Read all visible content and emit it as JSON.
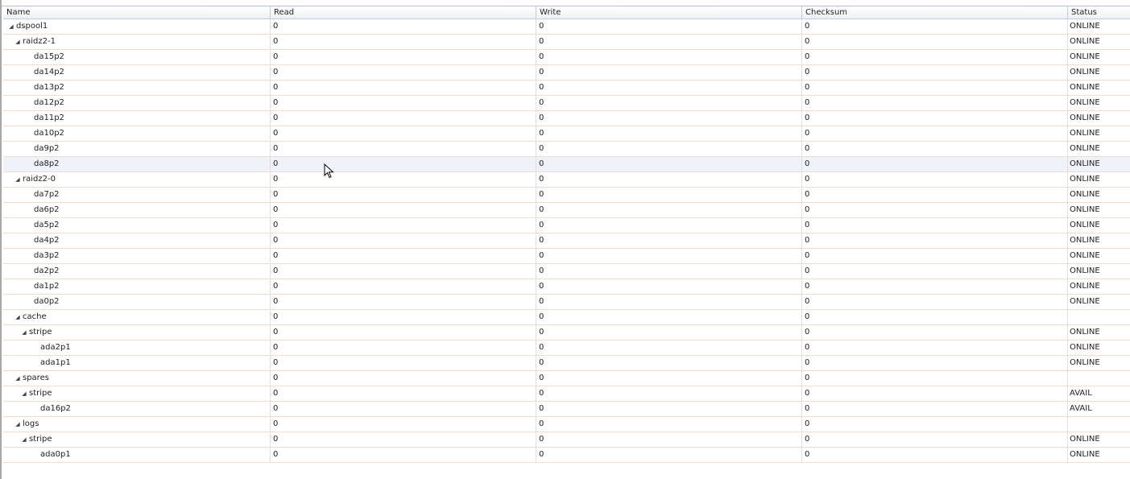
{
  "columns": {
    "name": "Name",
    "read": "Read",
    "write": "Write",
    "checksum": "Checksum",
    "status": "Status"
  },
  "rows": [
    {
      "name": "dspool1",
      "level": 0,
      "expandable": true,
      "read": "0",
      "write": "0",
      "checksum": "0",
      "status": "ONLINE"
    },
    {
      "name": "raidz2-1",
      "level": 1,
      "expandable": true,
      "read": "0",
      "write": "0",
      "checksum": "0",
      "status": "ONLINE"
    },
    {
      "name": "da15p2",
      "level": 2,
      "expandable": false,
      "read": "0",
      "write": "0",
      "checksum": "0",
      "status": "ONLINE"
    },
    {
      "name": "da14p2",
      "level": 2,
      "expandable": false,
      "read": "0",
      "write": "0",
      "checksum": "0",
      "status": "ONLINE"
    },
    {
      "name": "da13p2",
      "level": 2,
      "expandable": false,
      "read": "0",
      "write": "0",
      "checksum": "0",
      "status": "ONLINE"
    },
    {
      "name": "da12p2",
      "level": 2,
      "expandable": false,
      "read": "0",
      "write": "0",
      "checksum": "0",
      "status": "ONLINE"
    },
    {
      "name": "da11p2",
      "level": 2,
      "expandable": false,
      "read": "0",
      "write": "0",
      "checksum": "0",
      "status": "ONLINE"
    },
    {
      "name": "da10p2",
      "level": 2,
      "expandable": false,
      "read": "0",
      "write": "0",
      "checksum": "0",
      "status": "ONLINE"
    },
    {
      "name": "da9p2",
      "level": 2,
      "expandable": false,
      "read": "0",
      "write": "0",
      "checksum": "0",
      "status": "ONLINE"
    },
    {
      "name": "da8p2",
      "level": 2,
      "expandable": false,
      "read": "0",
      "write": "0",
      "checksum": "0",
      "status": "ONLINE",
      "selected": true
    },
    {
      "name": "raidz2-0",
      "level": 1,
      "expandable": true,
      "read": "0",
      "write": "0",
      "checksum": "0",
      "status": "ONLINE"
    },
    {
      "name": "da7p2",
      "level": 2,
      "expandable": false,
      "read": "0",
      "write": "0",
      "checksum": "0",
      "status": "ONLINE"
    },
    {
      "name": "da6p2",
      "level": 2,
      "expandable": false,
      "read": "0",
      "write": "0",
      "checksum": "0",
      "status": "ONLINE"
    },
    {
      "name": "da5p2",
      "level": 2,
      "expandable": false,
      "read": "0",
      "write": "0",
      "checksum": "0",
      "status": "ONLINE"
    },
    {
      "name": "da4p2",
      "level": 2,
      "expandable": false,
      "read": "0",
      "write": "0",
      "checksum": "0",
      "status": "ONLINE"
    },
    {
      "name": "da3p2",
      "level": 2,
      "expandable": false,
      "read": "0",
      "write": "0",
      "checksum": "0",
      "status": "ONLINE"
    },
    {
      "name": "da2p2",
      "level": 2,
      "expandable": false,
      "read": "0",
      "write": "0",
      "checksum": "0",
      "status": "ONLINE"
    },
    {
      "name": "da1p2",
      "level": 2,
      "expandable": false,
      "read": "0",
      "write": "0",
      "checksum": "0",
      "status": "ONLINE"
    },
    {
      "name": "da0p2",
      "level": 2,
      "expandable": false,
      "read": "0",
      "write": "0",
      "checksum": "0",
      "status": "ONLINE"
    },
    {
      "name": "cache",
      "level": 1,
      "expandable": true,
      "read": "0",
      "write": "0",
      "checksum": "0",
      "status": ""
    },
    {
      "name": "stripe",
      "level": 2,
      "expandable": true,
      "read": "0",
      "write": "0",
      "checksum": "0",
      "status": "ONLINE"
    },
    {
      "name": "ada2p1",
      "level": 3,
      "expandable": false,
      "read": "0",
      "write": "0",
      "checksum": "0",
      "status": "ONLINE"
    },
    {
      "name": "ada1p1",
      "level": 3,
      "expandable": false,
      "read": "0",
      "write": "0",
      "checksum": "0",
      "status": "ONLINE"
    },
    {
      "name": "spares",
      "level": 1,
      "expandable": true,
      "read": "0",
      "write": "0",
      "checksum": "0",
      "status": ""
    },
    {
      "name": "stripe",
      "level": 2,
      "expandable": true,
      "read": "0",
      "write": "0",
      "checksum": "0",
      "status": "AVAIL"
    },
    {
      "name": "da16p2",
      "level": 3,
      "expandable": false,
      "read": "0",
      "write": "0",
      "checksum": "0",
      "status": "AVAIL"
    },
    {
      "name": "logs",
      "level": 1,
      "expandable": true,
      "read": "0",
      "write": "0",
      "checksum": "0",
      "status": ""
    },
    {
      "name": "stripe",
      "level": 2,
      "expandable": true,
      "read": "0",
      "write": "0",
      "checksum": "0",
      "status": "ONLINE"
    },
    {
      "name": "ada0p1",
      "level": 3,
      "expandable": false,
      "read": "0",
      "write": "0",
      "checksum": "0",
      "status": "ONLINE"
    }
  ],
  "icons": {
    "expander": "expanded-triangle-icon",
    "cursor": "mouse-pointer-icon"
  }
}
